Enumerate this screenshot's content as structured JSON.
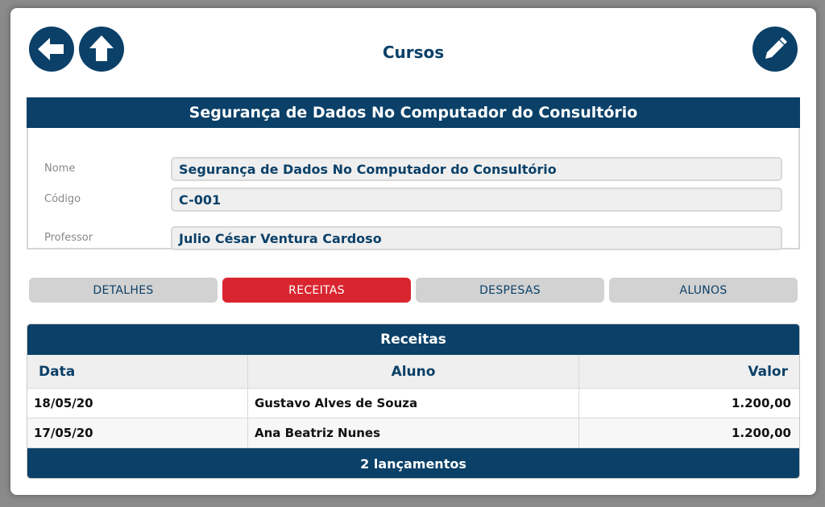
{
  "header": {
    "title": "Cursos",
    "back_icon": "arrow-left-icon",
    "home_icon": "arrow-up-icon",
    "edit_icon": "pencil-icon"
  },
  "course": {
    "heading": "Segurança de Dados No Computador do Consultório",
    "fields": {
      "nome_label": "Nome",
      "nome_value": "Segurança de Dados No Computador do Consultório",
      "codigo_label": "Código",
      "codigo_value": "C-001",
      "professor_label": "Professor",
      "professor_value": "Julio César Ventura Cardoso"
    }
  },
  "tabs": [
    {
      "label": "DETALHES",
      "active": false
    },
    {
      "label": "RECEITAS",
      "active": true
    },
    {
      "label": "DESPESAS",
      "active": false
    },
    {
      "label": "ALUNOS",
      "active": false
    }
  ],
  "receitas": {
    "title": "Receitas",
    "columns": {
      "data": "Data",
      "aluno": "Aluno",
      "valor": "Valor"
    },
    "rows": [
      {
        "data": "18/05/20",
        "aluno": "Gustavo Alves de Souza",
        "valor": "1.200,00"
      },
      {
        "data": "17/05/20",
        "aluno": "Ana Beatriz Nunes",
        "valor": "1.200,00"
      }
    ],
    "footer": "2 lançamentos"
  },
  "colors": {
    "primary": "#0b4068",
    "active_tab": "#d9252f",
    "tab_bg": "#d2d2d2",
    "field_bg": "#efefef"
  }
}
